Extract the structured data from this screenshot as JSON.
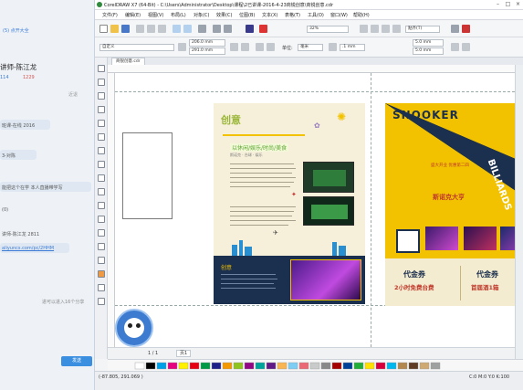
{
  "chat": {
    "line1": "(5) 点开大全",
    "name": "讲师-陈江龙",
    "stat1": "114",
    "stat2": "1229",
    "right_note": "近退",
    "msg1": "班课-在线 2016",
    "msg2": "3-对陈",
    "msg3": "能把这个在学 本人直播带学写",
    "msg4": "(0)",
    "msg5": "讲师-陈江龙 2811",
    "link": "aliyuncs.com/pc/2HHM",
    "send_label": "发送",
    "footer_note": "进可以进入16个分享"
  },
  "window": {
    "title": "CorelDRAW X7 (64-Bit) - C:\\Users\\Administrator\\Desktop\\课程\\2已讲课-2016-4-23商锐创意\\商锐创意.cdr"
  },
  "menu": [
    "文件(F)",
    "编辑(E)",
    "视图(V)",
    "布局(L)",
    "对象(C)",
    "效果(C)",
    "位图(B)",
    "文本(X)",
    "表格(T)",
    "工具(O)",
    "窗口(W)",
    "帮助(H)"
  ],
  "standard_toolbar": {
    "zoom": "32%",
    "snap_label": "贴齐(T)"
  },
  "property_bar": {
    "preset": "自定义",
    "width": "206.0 mm",
    "height": "291.0 mm",
    "units_label": "单位:",
    "units": "毫米",
    "nudge": ".1 mm",
    "dup_x": "5.0 mm",
    "dup_y": "5.0 mm"
  },
  "doc_tab": "商锐创意.cdr",
  "flyer1": {
    "logo": "创意",
    "headline": "以休闲/娱乐/时尚/美食",
    "tags": "斯诺克 · 台球 · 娱乐",
    "section": "创意"
  },
  "flyer2": {
    "title": "SNOOKER",
    "side": "BILLIARDS",
    "grand": "盛大开业 优惠第二四",
    "brand": "斯诺克大亨",
    "coupon_left_title": "代金券",
    "coupon_left_value": "2小时免费台费",
    "coupon_right_title": "代金券",
    "coupon_right_value": "首届酒1箱"
  },
  "page_nav": {
    "counter": "1 / 1",
    "page": "页1"
  },
  "status": {
    "coords": "(-87.805, 291.069 )",
    "color_model": "C:0 M:0 Y:0 K:100"
  },
  "colors": {
    "accent_yellow": "#f2c200",
    "navy": "#1b2f4e",
    "green_button": "#4caf50",
    "blue_button": "#3b8fe0"
  }
}
